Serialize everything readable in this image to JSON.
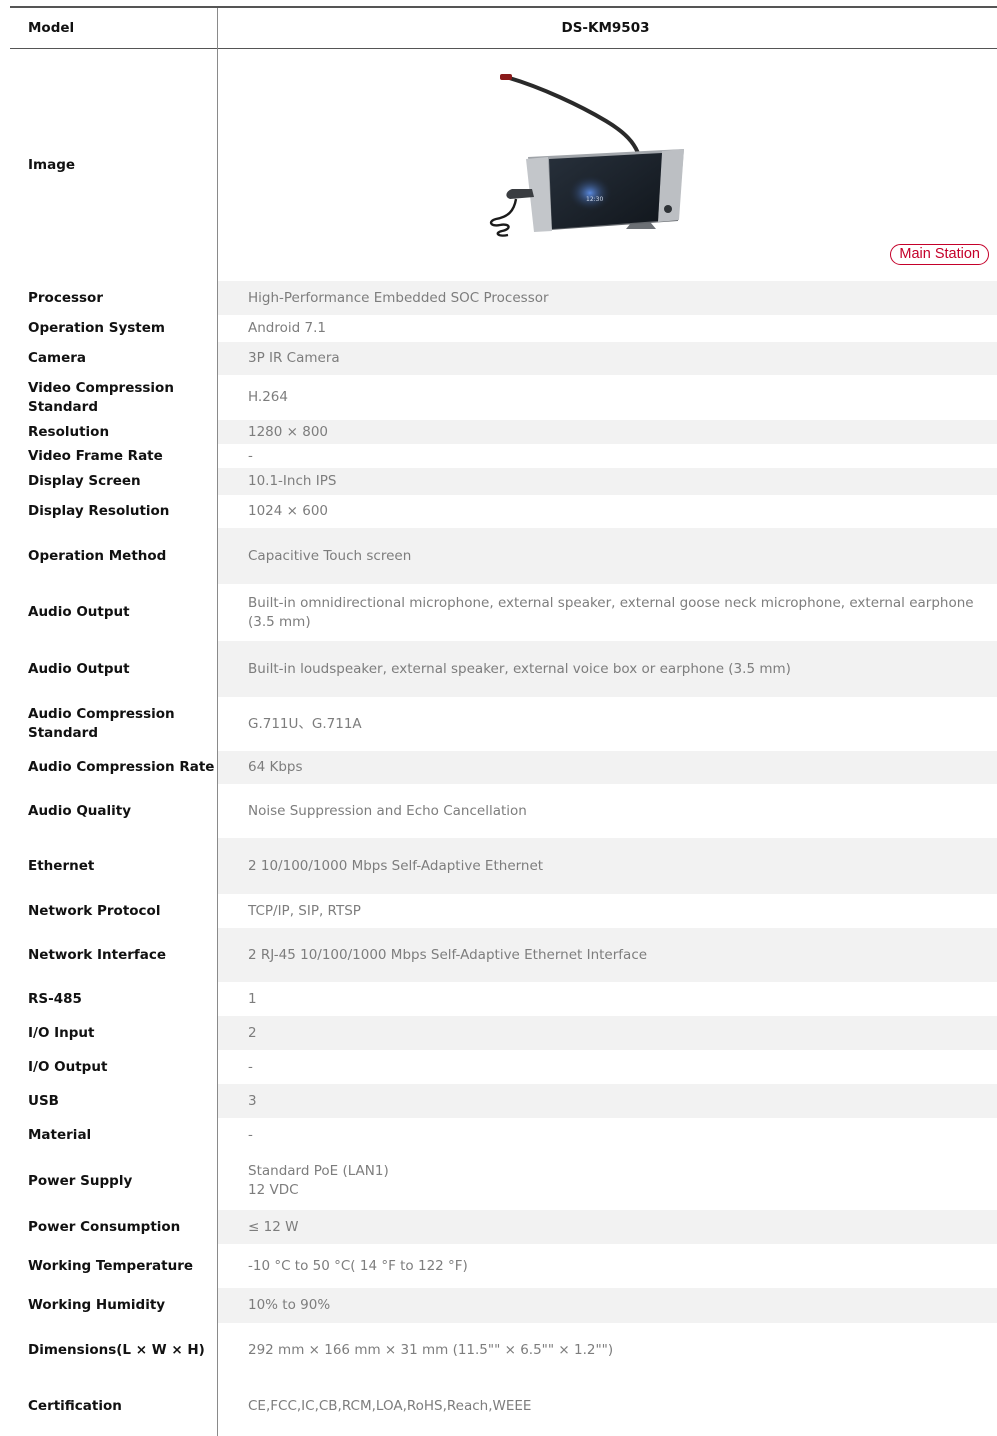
{
  "header": {
    "model_label": "Model",
    "model_value": "DS-KM9503"
  },
  "image_row": {
    "label": "Image",
    "badge": "Main Station",
    "screen_clock": "12:30"
  },
  "specs": [
    {
      "label": "Processor",
      "value": "High-Performance Embedded SOC Processor"
    },
    {
      "label": "Operation System",
      "value": "Android 7.1"
    },
    {
      "label": "Camera",
      "value": "3P IR Camera"
    },
    {
      "label": "Video Compression\nStandard",
      "value": "H.264"
    },
    {
      "label": "Resolution",
      "value": "1280 × 800"
    },
    {
      "label": "Video Frame Rate",
      "value": "-"
    },
    {
      "label": "Display Screen",
      "value": "10.1-Inch IPS"
    },
    {
      "label": "Display Resolution",
      "value": "1024 × 600"
    },
    {
      "label": "Operation Method",
      "value": "Capacitive Touch screen"
    },
    {
      "label": "Audio Output",
      "value": "Built-in omnidirectional microphone, external speaker, external goose neck microphone, external earphone (3.5 mm)"
    },
    {
      "label": "Audio Output",
      "value": "Built-in loudspeaker, external speaker, external voice box or earphone (3.5 mm)"
    },
    {
      "label": "Audio Compression\nStandard",
      "value": "G.711U、G.711A"
    },
    {
      "label": "Audio Compression Rate",
      "value": "64 Kbps"
    },
    {
      "label": "Audio Quality",
      "value": "Noise Suppression and Echo Cancellation"
    },
    {
      "label": "Ethernet",
      "value": "2 10/100/1000 Mbps Self-Adaptive Ethernet"
    },
    {
      "label": "Network Protocol",
      "value": " TCP/IP, SIP, RTSP"
    },
    {
      "label": "Network Interface",
      "value": "2 RJ-45 10/100/1000 Mbps Self-Adaptive Ethernet Interface"
    },
    {
      "label": "RS-485",
      "value": "1"
    },
    {
      "label": "I/O Input",
      "value": "2"
    },
    {
      "label": "I/O Output",
      "value": "-"
    },
    {
      "label": "USB",
      "value": "3"
    },
    {
      "label": "Material",
      "value": "-"
    },
    {
      "label": "Power Supply",
      "value": "Standard PoE (LAN1)\n12 VDC"
    },
    {
      "label": "Power Consumption",
      "value": "≤ 12 W"
    },
    {
      "label": "Working Temperature",
      "value": "-10 °C to 50 °C( 14 °F to 122 °F)"
    },
    {
      "label": "Working Humidity",
      "value": "10% to 90%"
    },
    {
      "label": "Dimensions(L × W × H)",
      "value": "292 mm × 166 mm × 31 mm (11.5\"\" × 6.5\"\" × 1.2\"\")"
    },
    {
      "label": "Certification",
      "value": "CE,FCC,IC,CB,RCM,LOA,RoHS,Reach,WEEE"
    }
  ]
}
